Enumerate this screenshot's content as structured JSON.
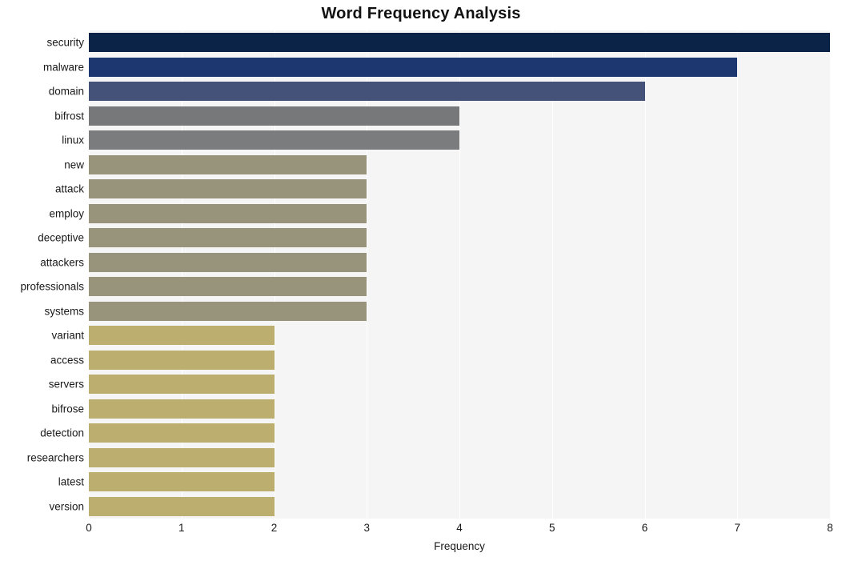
{
  "chart_data": {
    "type": "bar",
    "orientation": "horizontal",
    "title": "Word Frequency Analysis",
    "xlabel": "Frequency",
    "ylabel": "",
    "xlim": [
      0,
      8
    ],
    "xticks": [
      "0",
      "1",
      "2",
      "3",
      "4",
      "5",
      "6",
      "7",
      "8"
    ],
    "grid": true,
    "grid_axis": "x",
    "legend": "none",
    "plot_background": "#f5f5f6",
    "figure_background": "#ffffff",
    "gridline_color": "#ffffff",
    "categories": [
      "security",
      "malware",
      "domain",
      "bifrost",
      "linux",
      "new",
      "attack",
      "employ",
      "deceptive",
      "attackers",
      "professionals",
      "systems",
      "variant",
      "access",
      "servers",
      "bifrose",
      "detection",
      "researchers",
      "latest",
      "version"
    ],
    "values": [
      8,
      7,
      6,
      4,
      4,
      3,
      3,
      3,
      3,
      3,
      3,
      3,
      2,
      2,
      2,
      2,
      2,
      2,
      2,
      2
    ],
    "bar_colors": [
      "#0a2347",
      "#1d3871",
      "#44527a",
      "#77787a",
      "#7b7c7d",
      "#98947b",
      "#98947b",
      "#98947b",
      "#98947b",
      "#98947b",
      "#98947b",
      "#98947b",
      "#bcae6e",
      "#bcae6e",
      "#bcae6e",
      "#bcae6e",
      "#bcae6e",
      "#bcae6e",
      "#bcae6e",
      "#bcae6e"
    ]
  }
}
